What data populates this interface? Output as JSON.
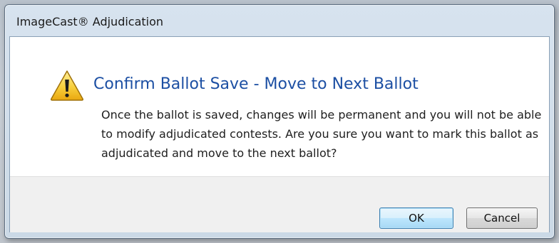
{
  "window": {
    "title": "ImageCast® Adjudication"
  },
  "dialog": {
    "heading": "Confirm Ballot Save - Move to Next Ballot",
    "message": "Once the ballot is saved, changes will be permanent and you will not be able to modify adjudicated contests. Are you sure you want to mark this ballot as adjudicated and move to the next ballot?",
    "icon": "warning-icon",
    "heading_color": "#1c4fa3"
  },
  "buttons": {
    "ok_label": "OK",
    "cancel_label": "Cancel"
  }
}
